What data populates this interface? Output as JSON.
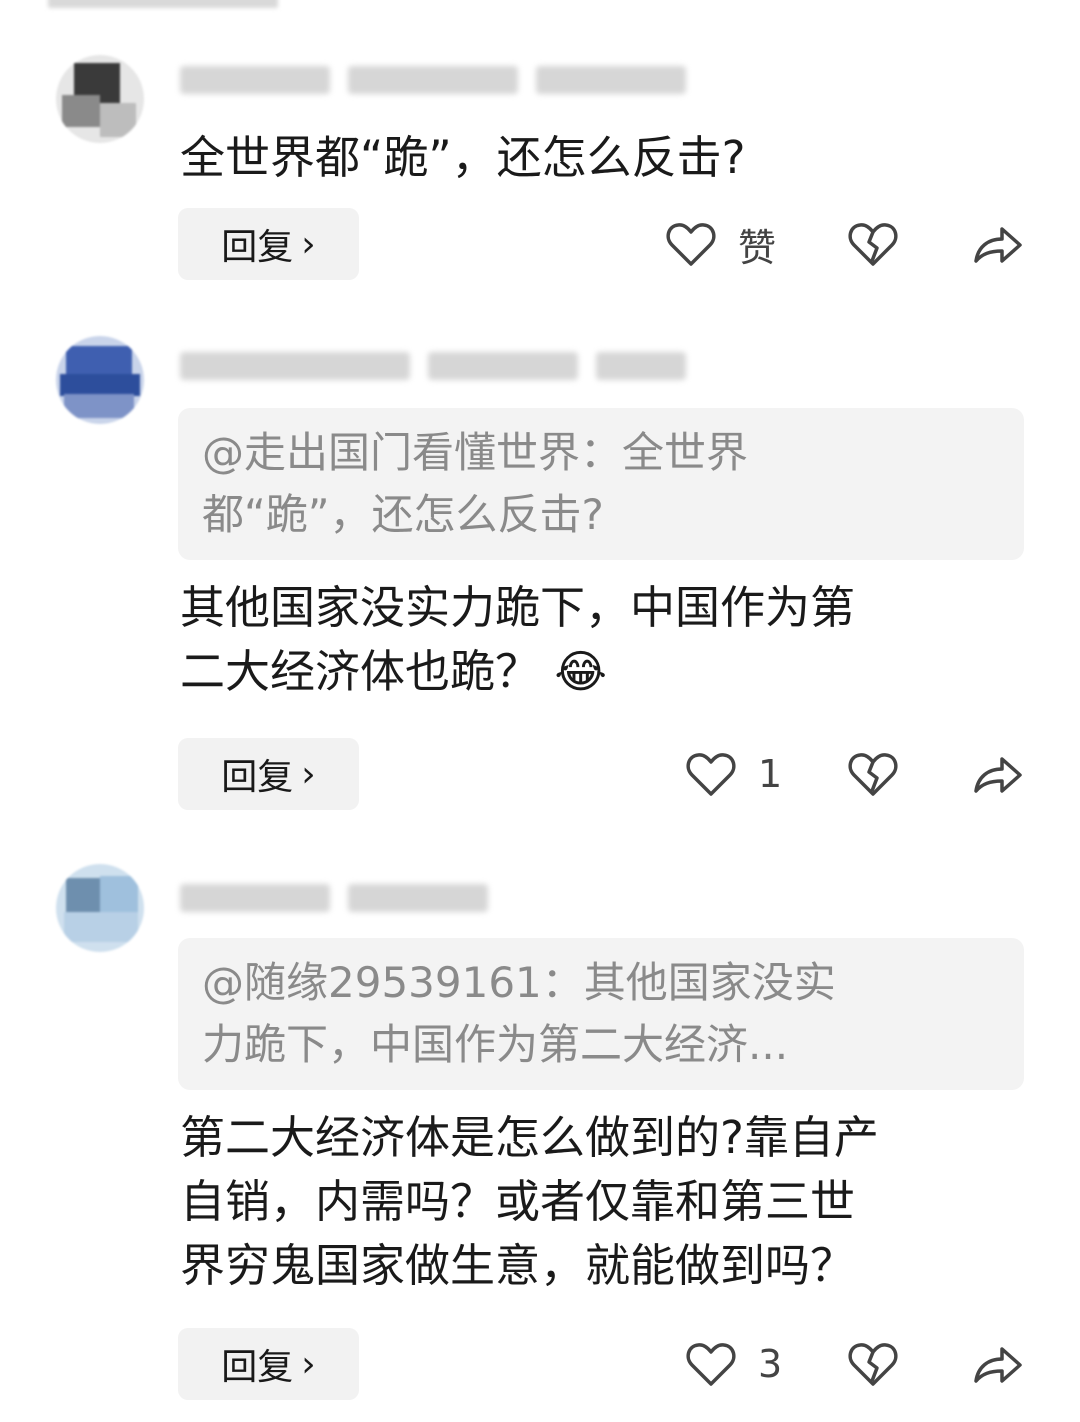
{
  "comments": [
    {
      "text": "全世界都“跪”，还怎么反击?",
      "reply_label": "回复",
      "like_label": "赞",
      "quote": ""
    },
    {
      "quote": "@走出国门看懂世界：全世界\n都“跪”，还怎么反击?",
      "text": "其他国家没实力跪下，中国作为第\n二大经济体也跪？",
      "emoji": "😂",
      "reply_label": "回复",
      "like_label": "1"
    },
    {
      "quote": "@随缘29539161：其他国家没实\n力跪下，中国作为第二大经济...",
      "text": "第二大经济体是怎么做到的?靠自产\n自销，内需吗？或者仅靠和第三世\n界穷鬼国家做生意，就能做到吗？",
      "reply_label": "回复",
      "like_label": "3"
    }
  ],
  "icons": {
    "chevron": "›",
    "like": "heart-outline-icon",
    "dislike": "broken-heart-icon",
    "share": "share-arrow-icon"
  },
  "colors": {
    "button_bg": "#f2f2f2",
    "quote_bg": "#f3f3f3",
    "quote_text": "#8a8a8a",
    "icon": "#444444"
  }
}
